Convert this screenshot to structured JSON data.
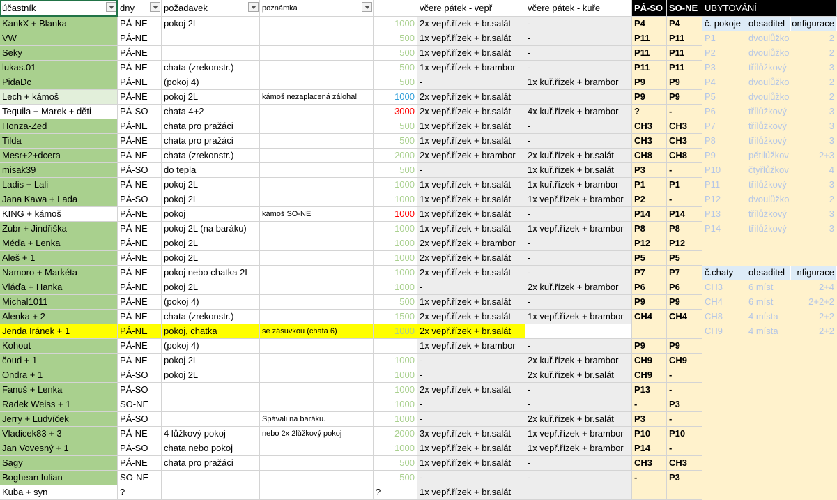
{
  "headers": {
    "ucastnik": "účastník",
    "dny": "dny",
    "pozadavek": "požadavek",
    "poznamka": "poznámka",
    "castka": "",
    "vepr": "včere pátek - vepř",
    "kure": "včere pátek - kuře",
    "paso": "PÁ-SO",
    "sone": "SO-NE",
    "ubytovani": "UBYTOVÁNÍ"
  },
  "rows": [
    {
      "name": "KankX + Blanka",
      "name_bg": "#a9d08e",
      "dny": "PÁ-NE",
      "pozadavek": "pokoj 2L",
      "poznamka": "",
      "castka": "1000",
      "castka_color": "#a9d08e",
      "vepr": "2x vepř.řízek + br.salát",
      "kure": "-",
      "paso": "P4",
      "sone": "P4"
    },
    {
      "name": "VW",
      "name_bg": "#a9d08e",
      "dny": "PÁ-NE",
      "pozadavek": "",
      "poznamka": "",
      "castka": "500",
      "castka_color": "#a9d08e",
      "vepr": "1x vepř.řízek + br.salát",
      "kure": "-",
      "paso": "P11",
      "sone": "P11"
    },
    {
      "name": "Seky",
      "name_bg": "#a9d08e",
      "dny": "PÁ-NE",
      "pozadavek": "",
      "poznamka": "",
      "castka": "500",
      "castka_color": "#a9d08e",
      "vepr": "1x vepř.řízek + br.salát",
      "kure": "-",
      "paso": "P11",
      "sone": "P11"
    },
    {
      "name": "lukas.01",
      "name_bg": "#a9d08e",
      "dny": "PÁ-NE",
      "pozadavek": "chata (zrekonstr.)",
      "poznamka": "",
      "castka": "500",
      "castka_color": "#a9d08e",
      "vepr": "1x vepř.řízek + brambor",
      "kure": "-",
      "paso": "P11",
      "sone": "P11"
    },
    {
      "name": "PidaDc",
      "name_bg": "#a9d08e",
      "dny": "PÁ-NE",
      "pozadavek": "(pokoj 4)",
      "poznamka": "",
      "castka": "500",
      "castka_color": "#a9d08e",
      "vepr": "-",
      "kure": "1x kuř.řízek + brambor",
      "paso": "P9",
      "sone": "P9"
    },
    {
      "name": "Lech + kámoš",
      "name_bg": "#e2efda",
      "dny": "PÁ-NE",
      "pozadavek": "pokoj 2L",
      "poznamka": "kámoš nezaplacená záloha!",
      "castka": "1000",
      "castka_color": "#2f9ed8",
      "vepr": "2x vepř.řízek + br.salát",
      "kure": "",
      "paso": "P9",
      "sone": "P9"
    },
    {
      "name": "Tequila + Marek + děti",
      "name_bg": "#ffffff",
      "dny": "PÁ-SO",
      "pozadavek": "chata 4+2",
      "poznamka": "",
      "castka": "3000",
      "castka_color": "#ff0000",
      "vepr": "2x vepř.řízek + br.salát",
      "kure": "4x kuř.řízek + brambor",
      "paso": "?",
      "sone": "-"
    },
    {
      "name": "Honza-Zed",
      "name_bg": "#a9d08e",
      "dny": "PÁ-NE",
      "pozadavek": "chata pro pražáci",
      "poznamka": "",
      "castka": "500",
      "castka_color": "#a9d08e",
      "vepr": "1x vepř.řízek + br.salát",
      "kure": "-",
      "paso": "CH3",
      "sone": "CH3"
    },
    {
      "name": "Tilda",
      "name_bg": "#a9d08e",
      "dny": "PÁ-NE",
      "pozadavek": "chata pro pražáci",
      "poznamka": "",
      "castka": "500",
      "castka_color": "#a9d08e",
      "vepr": "1x vepř.řízek + br.salát",
      "kure": "-",
      "paso": "CH3",
      "sone": "CH3"
    },
    {
      "name": "Mesr+2+dcera",
      "name_bg": "#a9d08e",
      "dny": "PÁ-NE",
      "pozadavek": "chata (zrekonstr.)",
      "poznamka": "",
      "castka": "2000",
      "castka_color": "#a9d08e",
      "vepr": "2x vepř.řízek + brambor",
      "kure": "2x kuř.řízek + br.salát",
      "paso": "CH8",
      "sone": "CH8"
    },
    {
      "name": "misak39",
      "name_bg": "#a9d08e",
      "dny": "PÁ-SO",
      "pozadavek": "do tepla",
      "poznamka": "",
      "castka": "500",
      "castka_color": "#a9d08e",
      "vepr": "-",
      "kure": "1x kuř.řízek + br.salát",
      "paso": "P3",
      "sone": "-"
    },
    {
      "name": "Ladis + Lali",
      "name_bg": "#a9d08e",
      "dny": "PÁ-NE",
      "pozadavek": "pokoj 2L",
      "poznamka": "",
      "castka": "1000",
      "castka_color": "#a9d08e",
      "vepr": "1x vepř.řízek + br.salát",
      "kure": "1x kuř.řízek + brambor",
      "paso": "P1",
      "sone": "P1"
    },
    {
      "name": "Jana Kawa + Lada",
      "name_bg": "#a9d08e",
      "dny": "PÁ-SO",
      "pozadavek": "pokoj 2L",
      "poznamka": "",
      "castka": "1000",
      "castka_color": "#a9d08e",
      "vepr": "1x vepř.řízek + br.salát",
      "kure": "1x vepř.řízek + brambor",
      "paso": "P2",
      "sone": "-"
    },
    {
      "name": "KING + kámoš",
      "name_bg": "#ffffff",
      "dny": "PÁ-NE",
      "pozadavek": "pokoj",
      "poznamka": "kámoš SO-NE",
      "castka": "1000",
      "castka_color": "#ff0000",
      "vepr": "1x vepř.řízek + br.salát",
      "kure": "-",
      "paso": "P14",
      "sone": "P14"
    },
    {
      "name": "Zubr + Jindřiška",
      "name_bg": "#a9d08e",
      "dny": "PÁ-NE",
      "pozadavek": "pokoj 2L (na baráku)",
      "poznamka": "",
      "castka": "1000",
      "castka_color": "#a9d08e",
      "vepr": "1x vepř.řízek + br.salát",
      "kure": "1x vepř.řízek + brambor",
      "paso": "P8",
      "sone": "P8"
    },
    {
      "name": "Méďa + Lenka",
      "name_bg": "#a9d08e",
      "dny": "PÁ-NE",
      "pozadavek": "pokoj 2L",
      "poznamka": "",
      "castka": "1000",
      "castka_color": "#a9d08e",
      "vepr": "2x vepř.řízek + brambor",
      "kure": "-",
      "paso": "P12",
      "sone": "P12"
    },
    {
      "name": "Aleš + 1",
      "name_bg": "#a9d08e",
      "dny": "PÁ-NE",
      "pozadavek": "pokoj 2L",
      "poznamka": "",
      "castka": "1000",
      "castka_color": "#a9d08e",
      "vepr": "2x vepř.řízek + br.salát",
      "kure": "-",
      "paso": "P5",
      "sone": "P5"
    },
    {
      "name": "Namoro + Markéta",
      "name_bg": "#a9d08e",
      "dny": "PÁ-NE",
      "pozadavek": "pokoj nebo chatka 2L",
      "poznamka": "",
      "castka": "1000",
      "castka_color": "#a9d08e",
      "vepr": "2x vepř.řízek + br.salát",
      "kure": "-",
      "paso": "P7",
      "sone": "P7"
    },
    {
      "name": "Vláďa + Hanka",
      "name_bg": "#a9d08e",
      "dny": "PÁ-NE",
      "pozadavek": "pokoj 2L",
      "poznamka": "",
      "castka": "1000",
      "castka_color": "#a9d08e",
      "vepr": "-",
      "kure": "2x kuř.řízek + brambor",
      "paso": "P6",
      "sone": "P6"
    },
    {
      "name": "Michal1011",
      "name_bg": "#a9d08e",
      "dny": "PÁ-NE",
      "pozadavek": "(pokoj 4)",
      "poznamka": "",
      "castka": "500",
      "castka_color": "#a9d08e",
      "vepr": "1x vepř.řízek + br.salát",
      "kure": "-",
      "paso": "P9",
      "sone": "P9"
    },
    {
      "name": "Alenka + 2",
      "name_bg": "#a9d08e",
      "dny": "PÁ-NE",
      "pozadavek": "chata (zrekonstr.)",
      "poznamka": "",
      "castka": "1500",
      "castka_color": "#a9d08e",
      "vepr": "2x vepř.řízek + br.salát",
      "kure": "1x vepř.řízek + brambor",
      "paso": "CH4",
      "sone": "CH4"
    },
    {
      "name": "Jenda Iránek + 1",
      "name_bg": "#ffff00",
      "dny": "PÁ-NE",
      "pozadavek": "pokoj, chatka",
      "poznamka": "se zásuvkou (chata 6)",
      "castka": "1000",
      "castka_color": "#a9d08e",
      "vepr": "2x vepř.řízek + br.salát",
      "kure": "",
      "paso": "",
      "sone": "",
      "highlight": true
    },
    {
      "name": "Kohout",
      "name_bg": "#a9d08e",
      "dny": "PÁ-NE",
      "pozadavek": "(pokoj 4)",
      "poznamka": "",
      "castka": "",
      "castka_color": "#a9d08e",
      "vepr": "1x vepř.řízek + brambor",
      "kure": "-",
      "paso": "P9",
      "sone": "P9"
    },
    {
      "name": "čoud + 1",
      "name_bg": "#a9d08e",
      "dny": "PÁ-NE",
      "pozadavek": "pokoj 2L",
      "poznamka": "",
      "castka": "1000",
      "castka_color": "#a9d08e",
      "vepr": "-",
      "kure": "2x kuř.řízek + brambor",
      "paso": "CH9",
      "sone": "CH9"
    },
    {
      "name": "Ondra + 1",
      "name_bg": "#a9d08e",
      "dny": "PÁ-SO",
      "pozadavek": "pokoj 2L",
      "poznamka": "",
      "castka": "1000",
      "castka_color": "#a9d08e",
      "vepr": "-",
      "kure": "2x kuř.řízek + br.salát",
      "paso": "CH9",
      "sone": "-"
    },
    {
      "name": "Fanuš + Lenka",
      "name_bg": "#a9d08e",
      "dny": "PÁ-SO",
      "pozadavek": "",
      "poznamka": "",
      "castka": "1000",
      "castka_color": "#a9d08e",
      "vepr": "2x vepř.řízek + br.salát",
      "kure": "-",
      "paso": "P13",
      "sone": "-"
    },
    {
      "name": "Radek Weiss + 1",
      "name_bg": "#a9d08e",
      "dny": "SO-NE",
      "pozadavek": "",
      "poznamka": "",
      "castka": "1000",
      "castka_color": "#a9d08e",
      "vepr": "-",
      "kure": "-",
      "paso": "-",
      "sone": "P3"
    },
    {
      "name": "Jerry + Ludvíček",
      "name_bg": "#a9d08e",
      "dny": "PÁ-SO",
      "pozadavek": "",
      "poznamka": "Spávali na baráku.",
      "castka": "1000",
      "castka_color": "#a9d08e",
      "vepr": "-",
      "kure": "2x kuř.řízek + br.salát",
      "paso": "P3",
      "sone": "-"
    },
    {
      "name": "Vladicek83 + 3",
      "name_bg": "#a9d08e",
      "dny": "PÁ-NE",
      "pozadavek": "4 lůžkový pokoj",
      "poznamka": "nebo 2x 2lůžkový pokoj",
      "castka": "2000",
      "castka_color": "#a9d08e",
      "vepr": "3x vepř.řízek + br.salát",
      "kure": "1x vepř.řízek + brambor",
      "paso": "P10",
      "sone": "P10"
    },
    {
      "name": "Jan Vovesný + 1",
      "name_bg": "#a9d08e",
      "dny": "PÁ-SO",
      "pozadavek": "chata nebo pokoj",
      "poznamka": "",
      "castka": "1000",
      "castka_color": "#a9d08e",
      "vepr": "1x vepř.řízek + br.salát",
      "kure": "1x vepř.řízek + brambor",
      "paso": "P14",
      "sone": "-"
    },
    {
      "name": "Sagy",
      "name_bg": "#a9d08e",
      "dny": "PÁ-NE",
      "pozadavek": "chata pro pražáci",
      "poznamka": "",
      "castka": "500",
      "castka_color": "#a9d08e",
      "vepr": "1x vepř.řízek + br.salát",
      "kure": "-",
      "paso": "CH3",
      "sone": "CH3"
    },
    {
      "name": "Boghean Iulian",
      "name_bg": "#a9d08e",
      "dny": "SO-NE",
      "pozadavek": "",
      "poznamka": "",
      "castka": "500",
      "castka_color": "#a9d08e",
      "vepr": "-",
      "kure": "-",
      "paso": "-",
      "sone": "P3"
    },
    {
      "name": "Kuba + syn",
      "name_bg": "#ffffff",
      "dny": "?",
      "pozadavek": "",
      "poznamka": "",
      "castka": "?",
      "castka_color": "#000000",
      "castka_left": true,
      "vepr": "1x vepř.řízek + br.salát",
      "kure": "",
      "paso": "",
      "sone": ""
    }
  ],
  "rooms": {
    "header_col1": "č. pokoje",
    "header_col2": "obsaditel",
    "header_col3": "onfigurace",
    "items": [
      {
        "id": "P1",
        "type": "dvoulůžko",
        "conf": "2"
      },
      {
        "id": "P2",
        "type": "dvoulůžko",
        "conf": "2"
      },
      {
        "id": "P3",
        "type": "třílůžkový",
        "conf": "3"
      },
      {
        "id": "P4",
        "type": "dvoulůžko",
        "conf": "2"
      },
      {
        "id": "P5",
        "type": "dvoulůžko",
        "conf": "2"
      },
      {
        "id": "P6",
        "type": "třílůžkový",
        "conf": "3"
      },
      {
        "id": "P7",
        "type": "třílůžkový",
        "conf": "3"
      },
      {
        "id": "P8",
        "type": "třílůžkový",
        "conf": "3"
      },
      {
        "id": "P9",
        "type": "pětilůžkov",
        "conf": "2+3"
      },
      {
        "id": "P10",
        "type": "čtyřlůžkov",
        "conf": "4"
      },
      {
        "id": "P11",
        "type": "třílůžkový",
        "conf": "3"
      },
      {
        "id": "P12",
        "type": "dvoulůžko",
        "conf": "2"
      },
      {
        "id": "P13",
        "type": "třílůžkový",
        "conf": "3"
      },
      {
        "id": "P14",
        "type": "třílůžkový",
        "conf": "3"
      }
    ]
  },
  "cabins": {
    "header_col1": "č.chaty",
    "header_col2": "obsaditel",
    "header_col3": "nfigurace",
    "items": [
      {
        "id": "CH3",
        "type": "6 míst",
        "conf": "2+4"
      },
      {
        "id": "CH4",
        "type": "6 míst",
        "conf": "2+2+2"
      },
      {
        "id": "CH8",
        "type": "4 místa",
        "conf": "2+2"
      },
      {
        "id": "CH9",
        "type": "4 místa",
        "conf": "2+2"
      }
    ]
  },
  "colors": {
    "green_paid": "#a9d08e",
    "grey_food": "#ededed",
    "accommodation_bg": "#fff2cc",
    "room_header_bg": "#ddebf7",
    "dark_header": "#000000",
    "highlight": "#ffff00",
    "faded_text": "#b4c6e7"
  }
}
